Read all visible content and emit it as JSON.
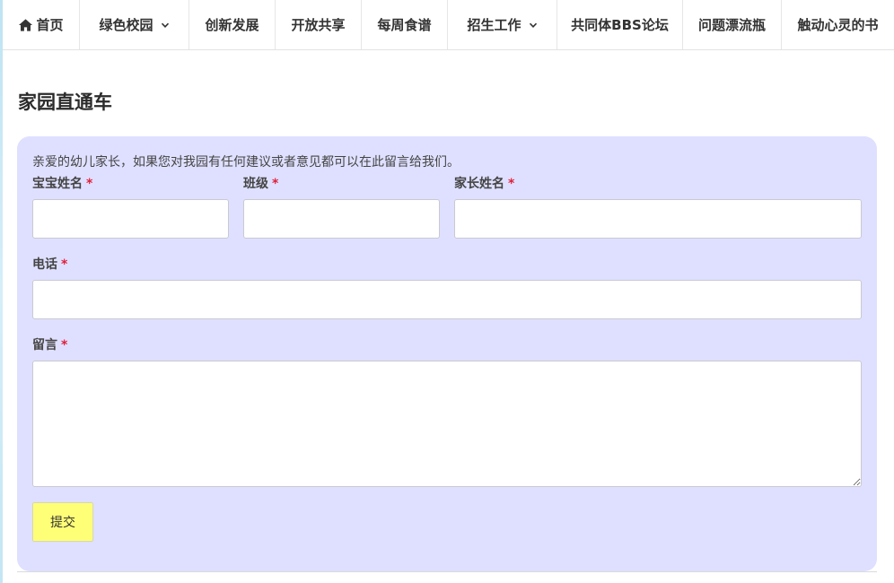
{
  "nav": {
    "items": [
      {
        "label": "首页"
      },
      {
        "label": "绿色校园"
      },
      {
        "label": "创新发展"
      },
      {
        "label": "开放共享"
      },
      {
        "label": "每周食谱"
      },
      {
        "label": "招生工作"
      },
      {
        "label": "共同体BBS论坛"
      },
      {
        "label": "问题漂流瓶"
      },
      {
        "label": "触动心灵的书"
      }
    ]
  },
  "page": {
    "title": "家园直通车"
  },
  "form": {
    "intro": "亲爱的幼儿家长，如果您对我园有任何建议或者意见都可以在此留言给我们。",
    "required_mark": "*",
    "fields": {
      "baby_name": {
        "label": "宝宝姓名",
        "value": "",
        "placeholder": ""
      },
      "class": {
        "label": "班级",
        "value": "",
        "placeholder": ""
      },
      "parent_name": {
        "label": "家长姓名",
        "value": "",
        "placeholder": ""
      },
      "phone": {
        "label": "电话",
        "value": "",
        "placeholder": ""
      },
      "message": {
        "label": "留言",
        "value": "",
        "placeholder": ""
      }
    },
    "submit_label": "提交"
  },
  "colors": {
    "panel_bg": "#dfe0ff",
    "submit_bg": "#ffff77",
    "required": "#e0203a"
  }
}
